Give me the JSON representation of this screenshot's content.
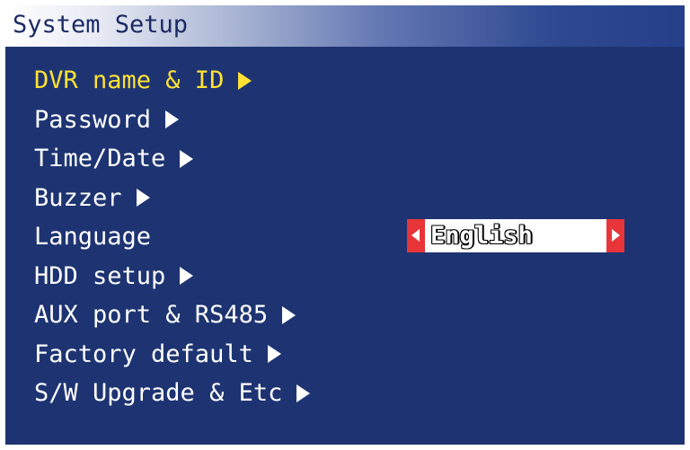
{
  "title": "System Setup",
  "menu": {
    "items": [
      {
        "label": "DVR name & ID",
        "selected": true,
        "has_submenu": true
      },
      {
        "label": "Password",
        "selected": false,
        "has_submenu": true
      },
      {
        "label": "Time/Date",
        "selected": false,
        "has_submenu": true
      },
      {
        "label": "Buzzer",
        "selected": false,
        "has_submenu": true
      },
      {
        "label": "Language",
        "selected": false,
        "has_submenu": false
      },
      {
        "label": "HDD setup",
        "selected": false,
        "has_submenu": true
      },
      {
        "label": "AUX port & RS485",
        "selected": false,
        "has_submenu": true
      },
      {
        "label": "Factory default",
        "selected": false,
        "has_submenu": true
      },
      {
        "label": "S/W Upgrade & Etc",
        "selected": false,
        "has_submenu": true
      }
    ]
  },
  "language": {
    "value": "English"
  },
  "colors": {
    "background": "#1e3472",
    "selected_text": "#ffe233",
    "normal_text": "#ffffff",
    "selector_cap": "#e8353a"
  },
  "icons": {
    "submenu": "right-triangle-icon",
    "prev": "left-triangle-icon",
    "next": "right-triangle-icon"
  }
}
